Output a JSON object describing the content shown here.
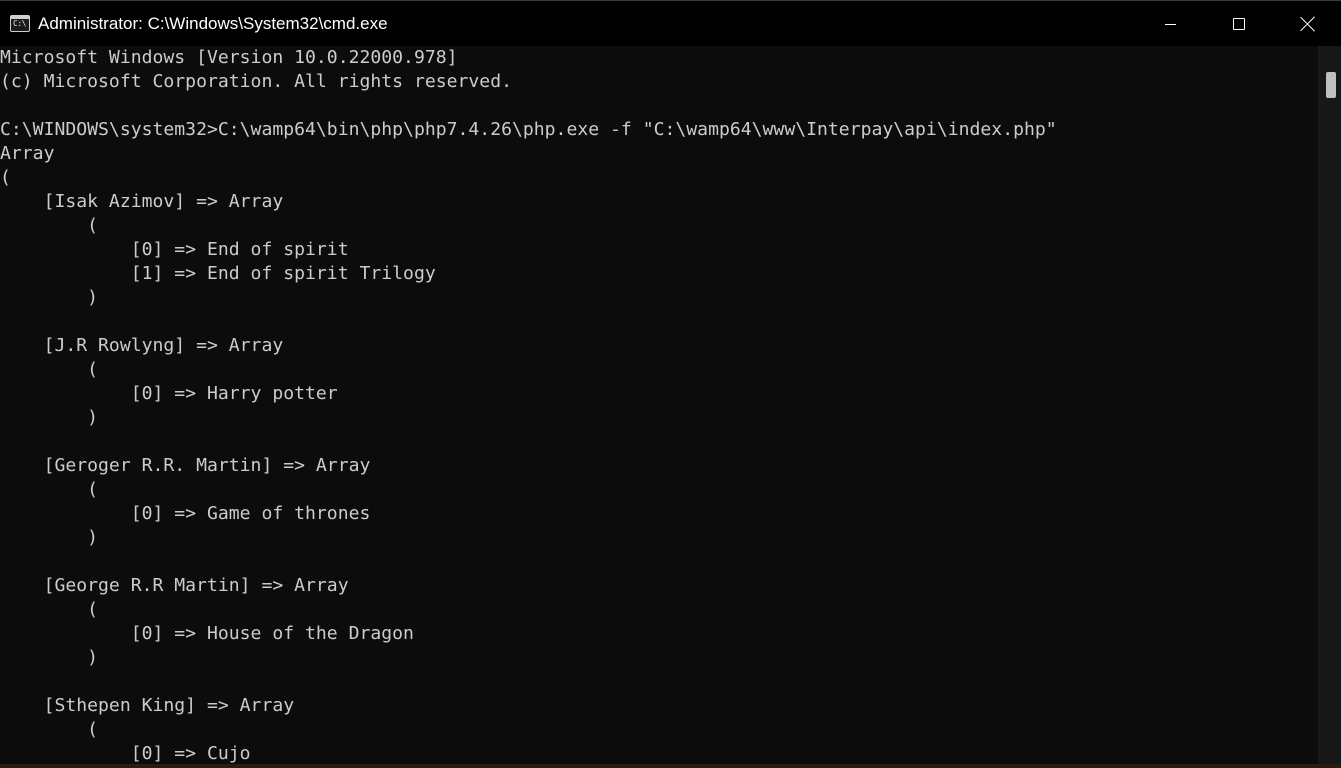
{
  "window": {
    "title": "Administrator: C:\\Windows\\System32\\cmd.exe",
    "icon": "cmd-icon",
    "icon_glyph": "C:\\",
    "controls": {
      "minimize": "minimize-icon",
      "maximize": "maximize-icon",
      "close": "close-icon"
    }
  },
  "console": {
    "lines": [
      "Microsoft Windows [Version 10.0.22000.978]",
      "(c) Microsoft Corporation. All rights reserved.",
      "",
      "C:\\WINDOWS\\system32>C:\\wamp64\\bin\\php\\php7.4.26\\php.exe -f \"C:\\wamp64\\www\\Interpay\\api\\index.php\"",
      "Array",
      "(",
      "    [Isak Azimov] => Array",
      "        (",
      "            [0] => End of spirit",
      "            [1] => End of spirit Trilogy",
      "        )",
      "",
      "    [J.R Rowlyng] => Array",
      "        (",
      "            [0] => Harry potter",
      "        )",
      "",
      "    [Geroger R.R. Martin] => Array",
      "        (",
      "            [0] => Game of thrones",
      "        )",
      "",
      "    [George R.R Martin] => Array",
      "        (",
      "            [0] => House of the Dragon",
      "        )",
      "",
      "    [Sthepen King] => Array",
      "        (",
      "            [0] => Cujo"
    ]
  },
  "colors": {
    "background": "#0c0c0c",
    "text": "#cccccc",
    "titlebar": "#000000",
    "title_text": "#ffffff"
  }
}
